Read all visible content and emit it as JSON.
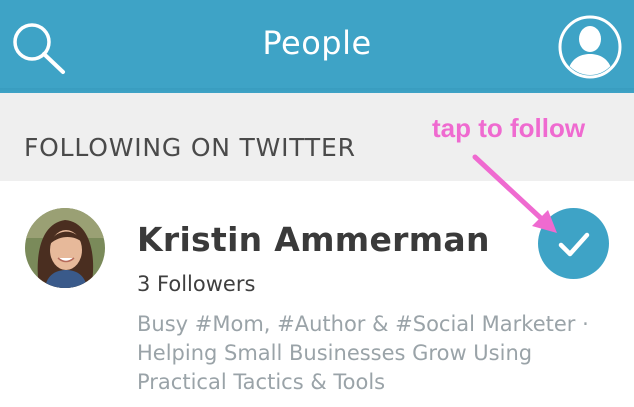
{
  "header": {
    "title": "People",
    "search_icon": "search-icon",
    "profile_icon": "profile-icon",
    "background": "#3ea3c6"
  },
  "section": {
    "title": "FOLLOWING ON TWITTER"
  },
  "annotation": {
    "text": "tap to follow",
    "color": "#ef6ad0"
  },
  "person": {
    "name": "Kristin Ammerman",
    "followers": "3 Followers",
    "bio": "Busy #Mom, #Author & #Social Marketer · Helping Small Businesses Grow Using Practical Tactics & Tools",
    "follow_icon": "checkmark-icon",
    "followed": true
  }
}
